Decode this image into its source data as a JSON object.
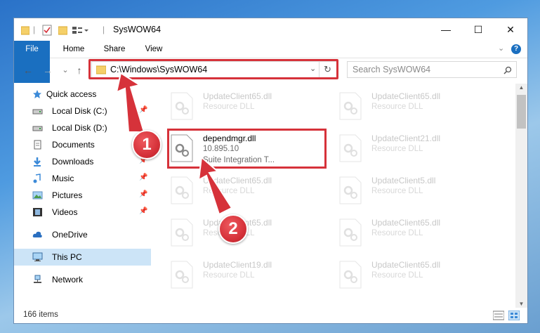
{
  "window": {
    "title": "SysWOW64"
  },
  "titlebar_buttons": {
    "minimize": "—",
    "maximize": "☐",
    "close": "✕"
  },
  "ribbon": {
    "tabs": [
      "File",
      "Home",
      "Share",
      "View"
    ],
    "help": "?"
  },
  "nav": {
    "back": "←",
    "forward": "→",
    "recent": "⌄",
    "up": "↑",
    "address": "C:\\Windows\\SysWOW64",
    "refresh": "↻",
    "search_placeholder": "Search SysWOW64"
  },
  "sidebar": [
    {
      "label": "Quick access",
      "icon": "star-icon",
      "pinned": false
    },
    {
      "label": "Local Disk (C:)",
      "icon": "drive-icon",
      "pinned": true
    },
    {
      "label": "Local Disk (D:)",
      "icon": "drive-icon",
      "pinned": false
    },
    {
      "label": "Documents",
      "icon": "documents-icon",
      "pinned": true
    },
    {
      "label": "Downloads",
      "icon": "download-icon",
      "pinned": true
    },
    {
      "label": "Music",
      "icon": "music-icon",
      "pinned": true
    },
    {
      "label": "Pictures",
      "icon": "pictures-icon",
      "pinned": true
    },
    {
      "label": "Videos",
      "icon": "videos-icon",
      "pinned": true
    },
    {
      "label": "OneDrive",
      "icon": "cloud-icon",
      "pinned": false
    },
    {
      "label": "This PC",
      "icon": "computer-icon",
      "pinned": false,
      "selected": true
    },
    {
      "label": "Network",
      "icon": "network-icon",
      "pinned": false
    }
  ],
  "pin_glyph": "📌",
  "files": [
    {
      "name": "UpdateClient65.dll",
      "type": "Resource DLL"
    },
    {
      "name": "UpdateClient65.dll",
      "type": "Resource DLL"
    },
    {
      "name": "dependmgr.dll",
      "version": "10.895.10",
      "type": "Suite Integration T...",
      "focus": true
    },
    {
      "name": "UpdateClient21.dll",
      "type": "Resource DLL"
    },
    {
      "name": "UpdateClient65.dll",
      "type": "Resource DLL"
    },
    {
      "name": "UpdateClient5.dll",
      "type": "Resource DLL"
    },
    {
      "name": "UpdateClient65.dll",
      "type": "Resource DLL"
    },
    {
      "name": "UpdateClient65.dll",
      "type": "Resource DLL"
    },
    {
      "name": "UpdateClient19.dll",
      "type": "Resource DLL"
    },
    {
      "name": "UpdateClient65.dll",
      "type": "Resource DLL"
    }
  ],
  "status": {
    "count": "166 items"
  },
  "callouts": [
    "1",
    "2"
  ],
  "colors": {
    "accent": "#1a6fc0",
    "highlight": "#d6323a",
    "selected": "#cce4f7"
  }
}
